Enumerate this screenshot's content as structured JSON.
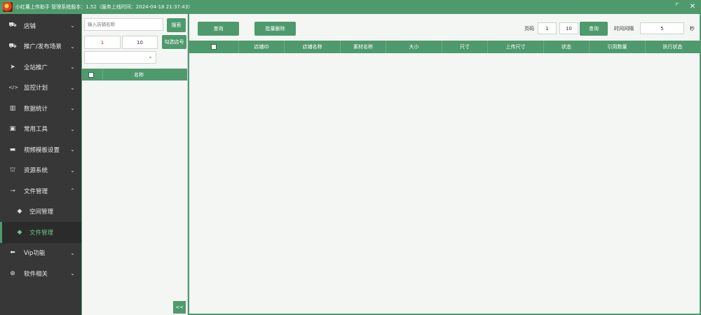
{
  "titlebar": {
    "title": "小红薯上传助手 管理系统版本：1.52（服务上线时间：2024-04-18 21:37:43）",
    "maximize_icon": "⌜",
    "close_icon": "✕"
  },
  "sidebar": {
    "items": [
      {
        "label": "店铺",
        "icon": "car-icon",
        "glyph": "⛟",
        "chevron": "⌄"
      },
      {
        "label": "推广/发布场景",
        "icon": "car-icon",
        "glyph": "⛟",
        "chevron": "⌄"
      },
      {
        "label": "全站推广",
        "icon": "navigation-icon",
        "glyph": "➤",
        "chevron": "⌄"
      },
      {
        "label": "监控计划",
        "icon": "code-icon",
        "glyph": "</>",
        "chevron": "⌄"
      },
      {
        "label": "数据统计",
        "icon": "bar-chart-icon",
        "glyph": "▥",
        "chevron": "⌄"
      },
      {
        "label": "常用工具",
        "icon": "contact-icon",
        "glyph": "▣",
        "chevron": "⌄"
      },
      {
        "label": "视频模板设置",
        "icon": "briefcase-icon",
        "glyph": "▬",
        "chevron": "⌄"
      },
      {
        "label": "资源系统",
        "icon": "bank-icon",
        "glyph": "⛫",
        "chevron": "⌄"
      },
      {
        "label": "文件管理",
        "icon": "key-icon",
        "glyph": "⊸",
        "chevron": "⌃"
      }
    ],
    "sub_items": [
      {
        "label": "空间管理",
        "icon": "tag-icon",
        "glyph": "◆"
      },
      {
        "label": "文件管理",
        "icon": "tag-icon",
        "glyph": "◆"
      }
    ],
    "bottom_items": [
      {
        "label": "Vip功能",
        "icon": "arrow-left-icon",
        "glyph": "⬅",
        "chevron": "⌄"
      },
      {
        "label": "软件相关",
        "icon": "download-circle-icon",
        "glyph": "⊕",
        "chevron": "⌄"
      }
    ]
  },
  "leftpanel": {
    "search_placeholder": "输入店铺名称",
    "search_button": "搜索",
    "page_value": "1",
    "size_value": "10",
    "select_button": "勾选店号",
    "select_chevron": "⌄",
    "header_name": "名称",
    "collapse_label": "<<"
  },
  "main": {
    "query_button": "查询",
    "batch_delete_button": "批量删除",
    "page_label": "页码",
    "page_value": "1",
    "size_value": "10",
    "query_button2": "查询",
    "interval_label": "时间间隔",
    "interval_value": "5",
    "interval_unit": "秒",
    "columns": [
      "店铺ID",
      "店铺名称",
      "素材名称",
      "大小",
      "尺寸",
      "上传尺寸",
      "状态",
      "引用数量",
      "执行状态"
    ]
  },
  "colors": {
    "accent": "#4f9a6d",
    "sidebar_bg": "#373737",
    "panel_bg": "#f4f6f4"
  }
}
